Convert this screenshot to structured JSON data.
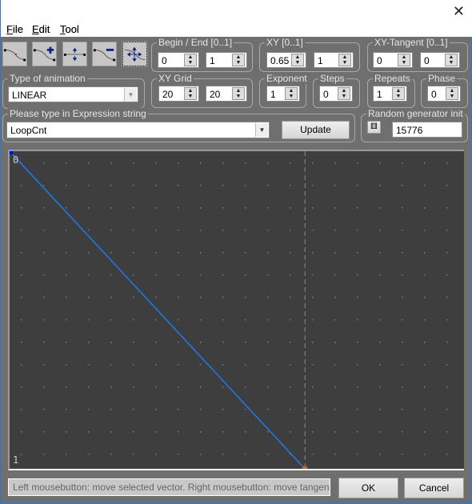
{
  "window": {
    "close_icon": "close-icon"
  },
  "menu": [
    {
      "label": "File",
      "key": "F",
      "rest": "ile"
    },
    {
      "label": "Edit",
      "key": "E",
      "rest": "dit"
    },
    {
      "label": "Tool",
      "key": "T",
      "rest": "ool"
    }
  ],
  "tools": [
    "curve-select-icon",
    "add-point-icon",
    "move-vertical-icon",
    "remove-point-icon",
    "move-all-icon"
  ],
  "begin_end": {
    "label": "Begin / End [0..1]",
    "begin": "0",
    "end": "1"
  },
  "xy": {
    "label": "XY [0..1]",
    "x": "0.65",
    "y": "1"
  },
  "xy_tangent": {
    "label": "XY-Tangent [0..1]",
    "x": "0",
    "y": "0"
  },
  "animation": {
    "label": "Type of animation",
    "value": "LINEAR"
  },
  "xy_grid": {
    "label": "XY Grid",
    "x": "20",
    "y": "20"
  },
  "exponent": {
    "label": "Exponent",
    "value": "1"
  },
  "steps": {
    "label": "Steps",
    "value": "0"
  },
  "repeats": {
    "label": "Repeats",
    "value": "1"
  },
  "phase": {
    "label": "Phase",
    "value": "0"
  },
  "expression": {
    "label": "Please type in Expression string",
    "value": "LoopCnt",
    "update": "Update"
  },
  "random": {
    "label": "Random generator init",
    "value": "15776"
  },
  "graph": {
    "top_label": "0",
    "bottom_label": "1",
    "line_color": "#1a7cf0",
    "marker_color": "#e0601a",
    "selected_x": 0.65
  },
  "status": "Left mousebutton: move selected vector. Right mousebutton: move tangent of sele",
  "ok": "OK",
  "cancel": "Cancel"
}
